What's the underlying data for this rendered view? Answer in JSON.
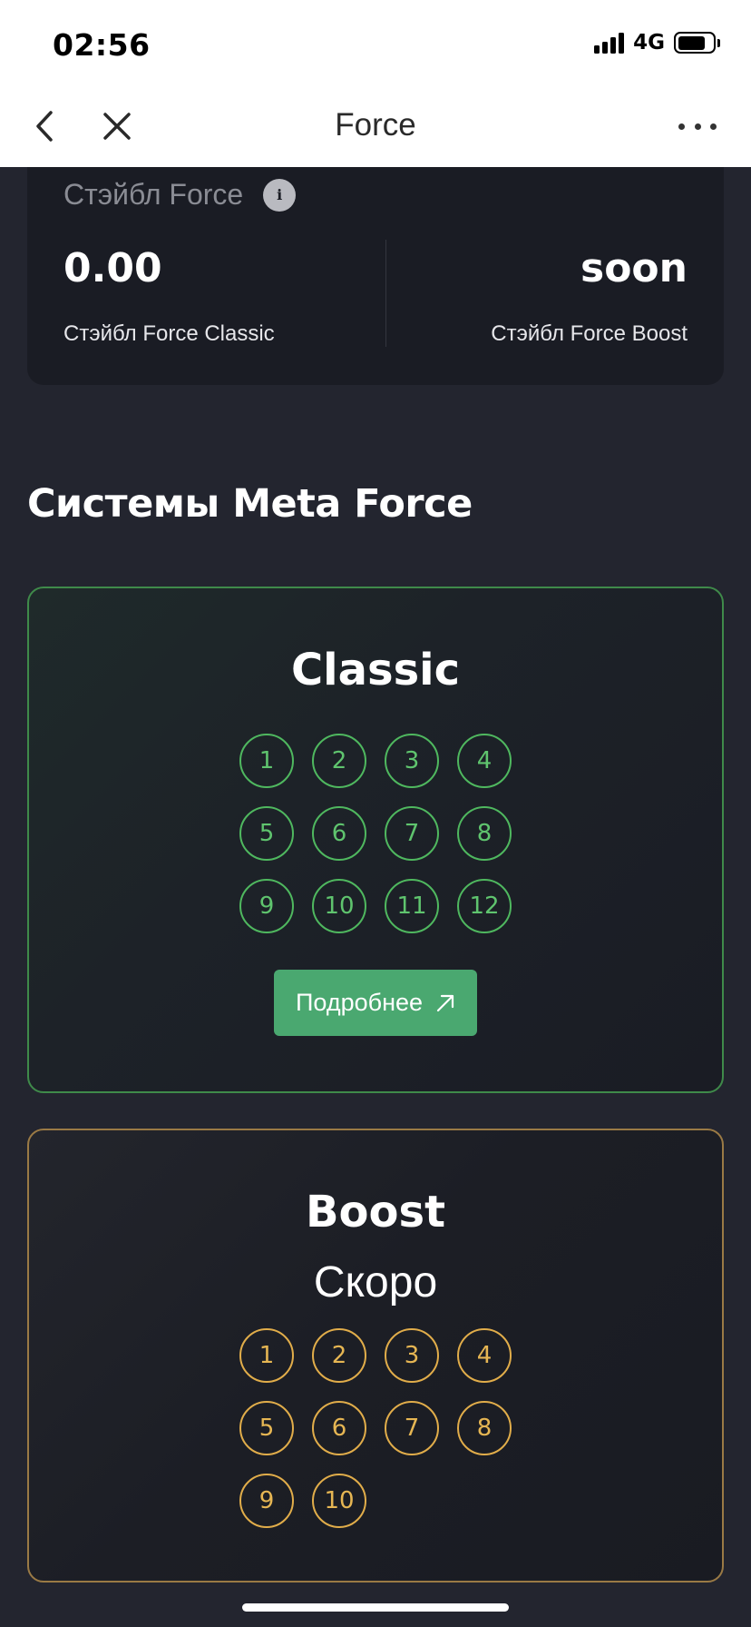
{
  "status_bar": {
    "time": "02:56",
    "network": "4G",
    "icons": [
      "signal-icon",
      "battery-icon"
    ]
  },
  "nav": {
    "title": "Force",
    "icons": [
      "back-chevron-icon",
      "close-icon",
      "more-dots-icon"
    ]
  },
  "stable": {
    "title": "Стэйбл Force",
    "info_icon": "i",
    "classic_value": "0.00",
    "classic_label": "Стэйбл Force Classic",
    "boost_value": "soon",
    "boost_label": "Стэйбл Force Boost"
  },
  "section": {
    "title": "Системы Meta Force"
  },
  "classic": {
    "title": "Classic",
    "accent_color": "#4fb85f",
    "levels": [
      "1",
      "2",
      "3",
      "4",
      "5",
      "6",
      "7",
      "8",
      "9",
      "10",
      "11",
      "12"
    ],
    "button_label": "Подробнее",
    "button_color": "#4aa870"
  },
  "boost": {
    "title": "Boost",
    "subtitle": "Скоро",
    "accent_color": "#e1ad4a",
    "levels": [
      "1",
      "2",
      "3",
      "4",
      "5",
      "6",
      "7",
      "8",
      "9",
      "10"
    ]
  }
}
